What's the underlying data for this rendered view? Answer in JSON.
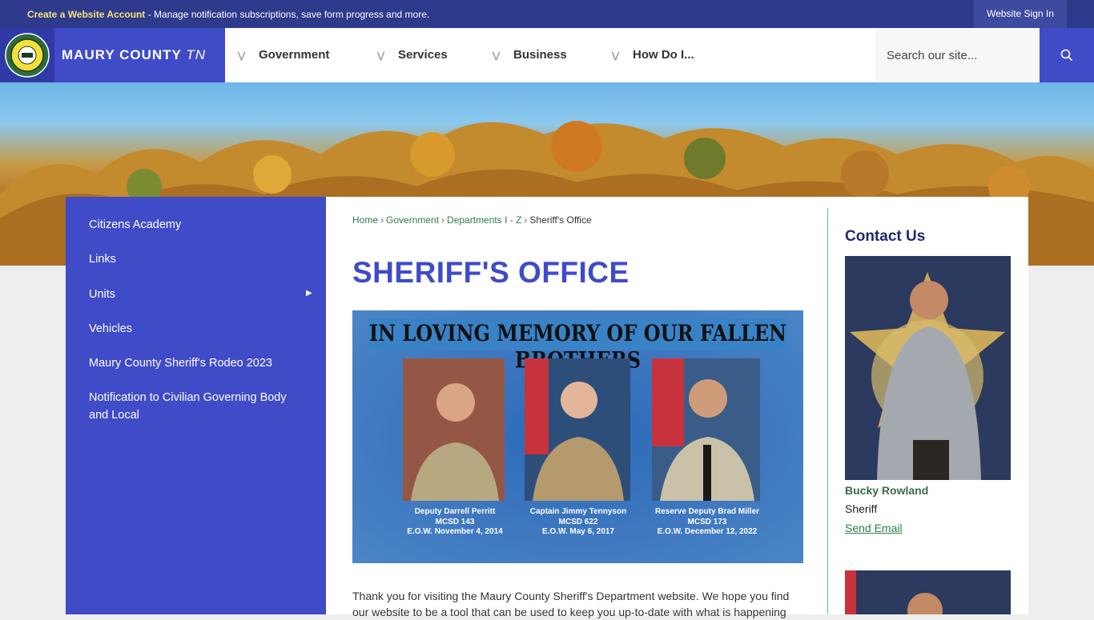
{
  "topbar": {
    "account_link": "Create a Website Account",
    "account_desc": " - Manage notification subscriptions, save form progress and more.",
    "signin": "Website Sign In"
  },
  "header": {
    "brand": "MAURY COUNTY",
    "brand_suffix": "TN",
    "nav": [
      "Government",
      "Services",
      "Business",
      "How Do I..."
    ],
    "search_placeholder": "Search our site..."
  },
  "sidebar": {
    "items": [
      "Citizens Academy",
      "Links",
      "Units",
      "Vehicles",
      "Maury County Sheriff's Rodeo 2023",
      "Notification to Civilian Governing Body and Local"
    ]
  },
  "breadcrumb": {
    "items": [
      "Home",
      "Government",
      "Departments I - Z"
    ],
    "current": "Sheriff's Office"
  },
  "page": {
    "title": "SHERIFF'S OFFICE",
    "memorial_title": "IN LOVING MEMORY OF OUR  FALLEN BROTHERS",
    "memorial": [
      {
        "name": "Deputy Darrell Perritt",
        "badge": "MCSD 143",
        "eow": "E.O.W. November 4, 2014"
      },
      {
        "name": "Captain Jimmy Tennyson",
        "badge": "MCSD 622",
        "eow": "E.O.W. May 6, 2017"
      },
      {
        "name": "Reserve Deputy Brad Miller",
        "badge": "MCSD 173",
        "eow": "E.O.W. December 12, 2022"
      }
    ],
    "intro": "Thank you for visiting the Maury County Sheriff's Department website. We hope you find our website to be a tool that can be used to keep you up-to-date with what is happening"
  },
  "contact": {
    "title": "Contact Us",
    "name": "Bucky Rowland",
    "role": "Sheriff",
    "email_link": "Send Email"
  },
  "colors": {
    "primary": "#3f4bc7",
    "topbar": "#2e3a8c",
    "link_green": "#2e7d4a"
  }
}
